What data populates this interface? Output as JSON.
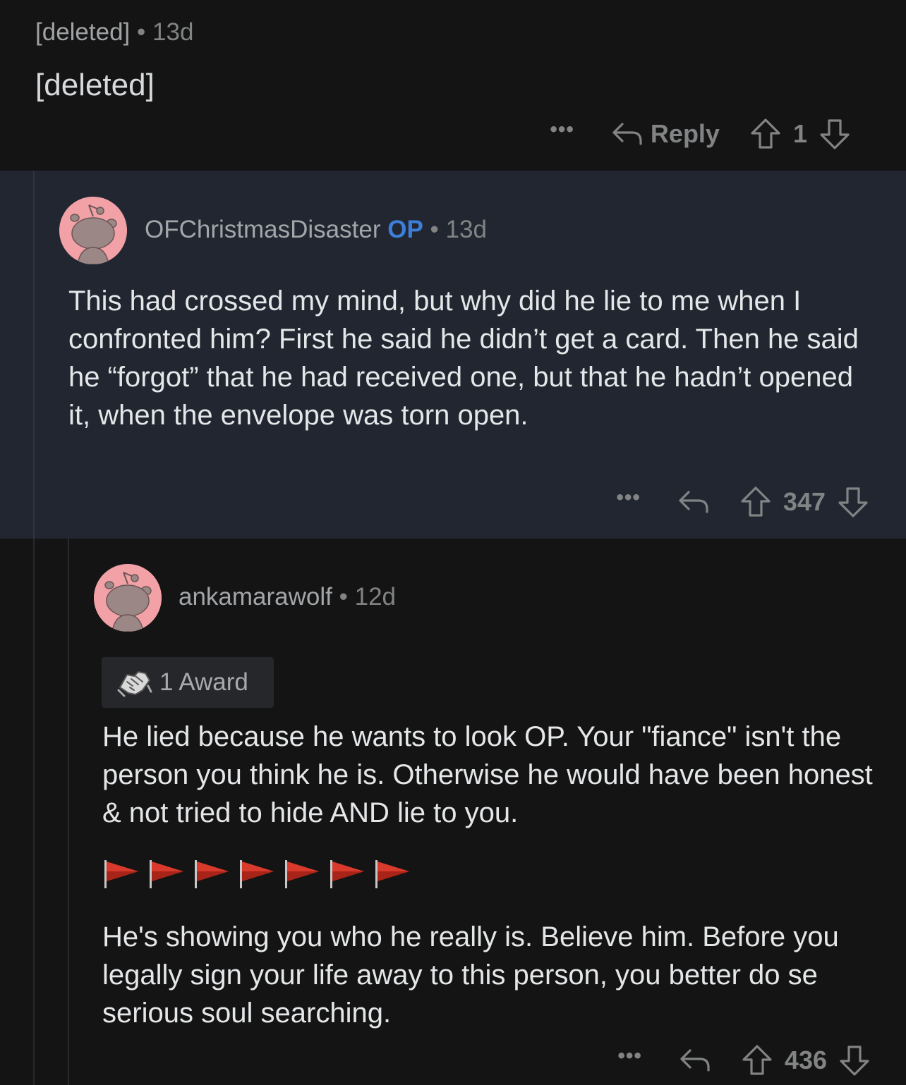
{
  "comments": [
    {
      "author": "[deleted]",
      "age": "13d",
      "body": "[deleted]",
      "more_label": "•••",
      "reply_label": "Reply",
      "score": "1"
    },
    {
      "author": "OFChristmasDisaster",
      "op_badge": "OP",
      "age": "13d",
      "body": "This had crossed my mind, but why did he lie to me when I confronted him? First he said he didn’t get a card. Then he said he “forgot” that he had received one, but that he hadn’t opened it, when the envelope was torn open.",
      "more_label": "•••",
      "score": "347"
    },
    {
      "author": "ankamarawolf",
      "age": "12d",
      "award_label": "1 Award",
      "award_icon": "handshake-icon",
      "body_paragraph_1": "He lied because he wants to look OP. Your \"fiance\" isn't the person you think he is. Otherwise he would have been honest & not tried to hide AND lie to you.",
      "flag_count": 7,
      "flag_icon": "red-triangular-flag-icon",
      "body_paragraph_2": "He's showing you who he really is. Believe him. Before you legally sign your life away to this person, you better do se serious soul searching.",
      "more_label": "•••",
      "score": "436"
    }
  ],
  "separator": "•",
  "colors": {
    "background": "#141414",
    "highlight_background": "#212631",
    "op_blue": "#3d7ed9",
    "avatar_pink": "#f2a1a6",
    "muted_text": "#818384",
    "flag_red": "#d93a2b"
  }
}
